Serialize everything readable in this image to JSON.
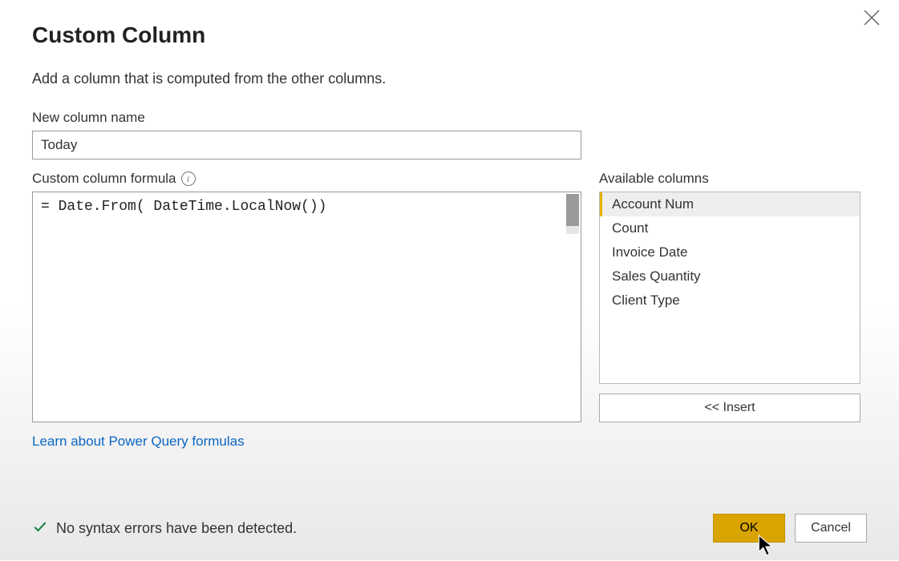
{
  "dialog": {
    "title": "Custom Column",
    "subtitle": "Add a column that is computed from the other columns."
  },
  "fields": {
    "name_label": "New column name",
    "name_value": "Today",
    "formula_label": "Custom column formula",
    "formula_value": "= Date.From( DateTime.LocalNow())",
    "available_label": "Available columns"
  },
  "available_columns": {
    "items": [
      "Account Num",
      "Count",
      "Invoice Date",
      "Sales Quantity",
      "Client Type"
    ],
    "selected_index": 0
  },
  "buttons": {
    "insert": "<< Insert",
    "ok": "OK",
    "cancel": "Cancel"
  },
  "link": {
    "learn": "Learn about Power Query formulas"
  },
  "status": {
    "message": "No syntax errors have been detected."
  }
}
